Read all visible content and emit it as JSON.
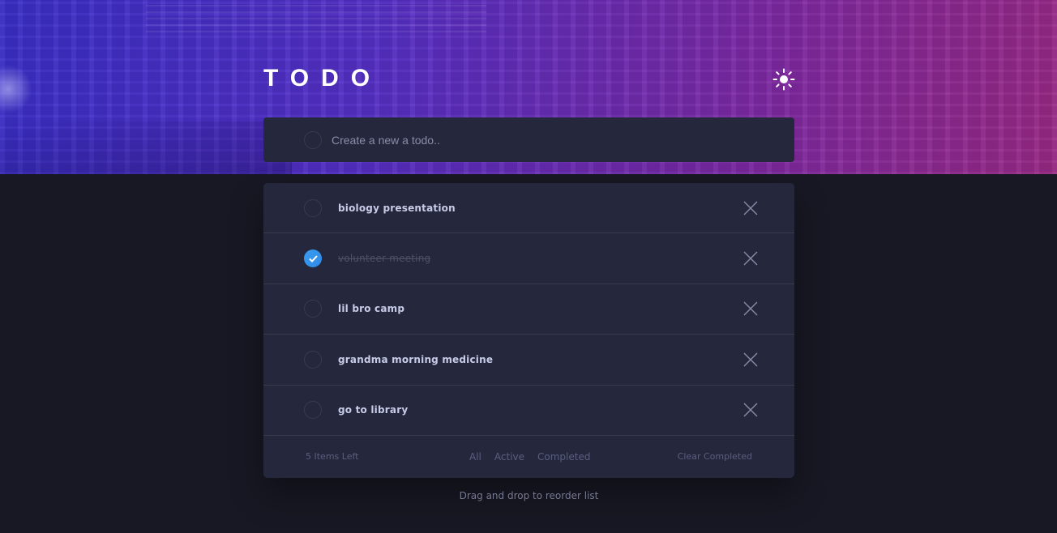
{
  "header": {
    "title": "TODO",
    "theme_toggle_icon": "sun-icon"
  },
  "new_todo": {
    "placeholder": "Create a new a todo.."
  },
  "todos": [
    {
      "label": "biology presentation",
      "completed": false
    },
    {
      "label": "volunteer meeting",
      "completed": true
    },
    {
      "label": "lil bro camp",
      "completed": false
    },
    {
      "label": "grandma morning medicine",
      "completed": false
    },
    {
      "label": "go to library",
      "completed": false
    }
  ],
  "footer": {
    "items_left": "5 Items Left",
    "filters": [
      "All",
      "Active",
      "Completed"
    ],
    "clear": "Clear Completed"
  },
  "hint": "Drag and drop to reorder list",
  "colors": {
    "background": "#171823",
    "card": "#25273d",
    "accent_check": "#3a9bf0",
    "text": "#c8cbe7",
    "muted": "#5b5e7e"
  }
}
